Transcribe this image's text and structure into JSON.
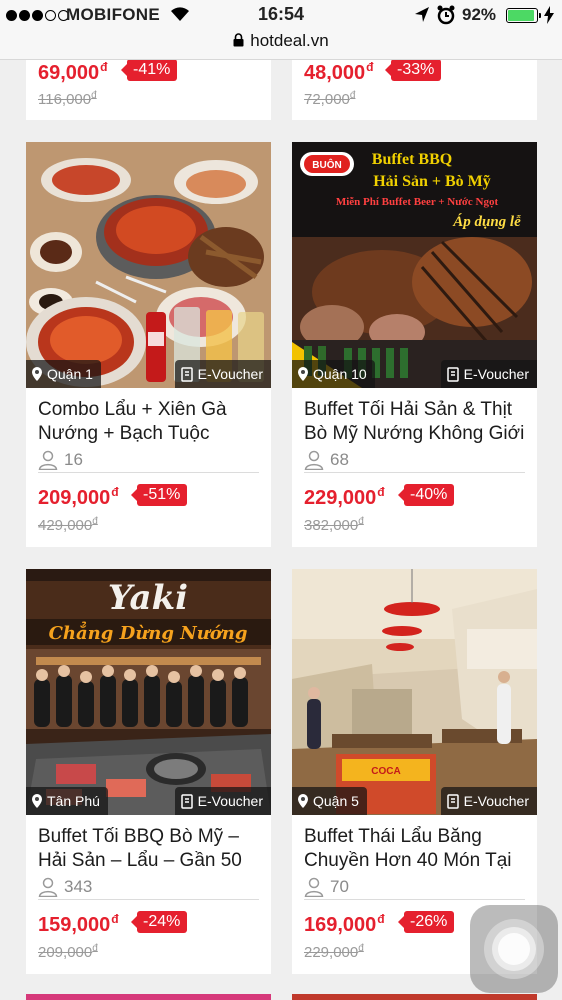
{
  "status_bar": {
    "carrier": "MOBIFONE",
    "time": "16:54",
    "battery": "92%",
    "battery_level": 0.92
  },
  "url_bar": {
    "domain": "hotdeal.vn"
  },
  "partial_cards": [
    {
      "price": "69,000",
      "discount": "-41%",
      "old_price": "116,000"
    },
    {
      "price": "48,000",
      "discount": "-33%",
      "old_price": "72,000"
    }
  ],
  "currency_symbol": "đ",
  "cards": [
    {
      "district": "Quận 1",
      "voucher": "E-Voucher",
      "title_line1": "Combo Lẩu + Xiên Gà",
      "title_line2": "Nướng + Bạch Tuộc",
      "buyers": "16",
      "price": "209,000",
      "discount": "-51%",
      "old_price": "429,000",
      "image": "hotpot-combo"
    },
    {
      "district": "Quận 10",
      "voucher": "E-Voucher",
      "title_line1": "Buffet Tối Hải Sản & Thịt",
      "title_line2": "Bò Mỹ Nướng Không Giới",
      "buyers": "68",
      "price": "229,000",
      "discount": "-40%",
      "old_price": "382,000",
      "image": "bbq-banner",
      "banner": {
        "logo": "BUÔN",
        "line1": "Buffet BBQ",
        "line2": "Hải Sản + Bò Mỹ",
        "line3": "Miễn Phí Buffet Beer + Nước Ngọt",
        "line4": "Áp dụng lễ"
      }
    },
    {
      "district": "Tân Phú",
      "voucher": "E-Voucher",
      "title_line1": "Buffet Tối BBQ Bò Mỹ –",
      "title_line2": "Hải Sản – Lẩu – Gần 50",
      "buyers": "343",
      "price": "159,000",
      "discount": "-24%",
      "old_price": "209,000",
      "image": "yaki-restaurant",
      "sign": {
        "brand": "Yaki",
        "slogan": "Chẳng Dừng Nướng"
      }
    },
    {
      "district": "Quận 5",
      "voucher": "E-Voucher",
      "title_line1": "Buffet Thái Lẩu Băng",
      "title_line2": "Chuyền Hơn 40 Món Tại",
      "buyers": "70",
      "price": "169,000",
      "discount": "-26%",
      "old_price": "229,000",
      "image": "restaurant-interior",
      "sign": {
        "brand": "COCA"
      }
    }
  ]
}
